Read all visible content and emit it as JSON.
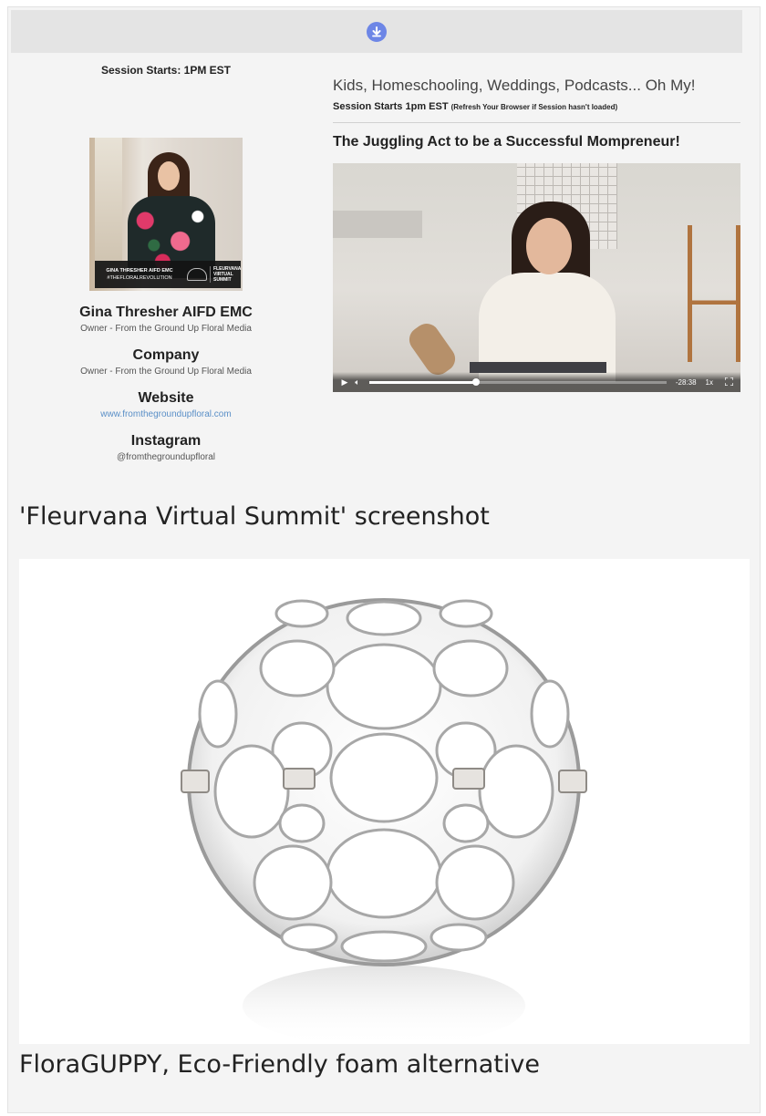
{
  "topbar": {
    "download_icon": "download-circle-icon"
  },
  "left": {
    "session_start": "Session Starts: 1PM EST",
    "photo_banner": {
      "name": "GINA THRESHER AIFD EMC",
      "hashtag": "#THEFLORALREVOLUTION",
      "brand": "FLEURVANA VIRTUAL SUMMIT"
    },
    "speaker_name": "Gina Thresher AIFD EMC",
    "speaker_role": "Owner - From the Ground Up Floral Media",
    "company_title": "Company",
    "company_value": "Owner - From the Ground Up Floral Media",
    "website_title": "Website",
    "website_link": "www.fromthegroundupfloral.com",
    "instagram_title": "Instagram",
    "instagram_handle": "@fromthegroundupfloral"
  },
  "right": {
    "series_title": "Kids, Homeschooling, Weddings, Podcasts... Oh My!",
    "session_start": "Session Starts 1pm EST",
    "session_note": "(Refresh Your Browser if Session hasn't loaded)",
    "talk_title": "The Juggling Act to be a Successful Mompreneur!",
    "video": {
      "time_remaining": "-28:38",
      "speed": "1x",
      "progress": 0.36
    }
  },
  "captions": {
    "first": "'Fleurvana Virtual Summit' screenshot",
    "second": "FloraGUPPY, Eco-Friendly foam alternative"
  },
  "colors": {
    "accent": "#6d86e6",
    "link": "#5a8fc7"
  }
}
